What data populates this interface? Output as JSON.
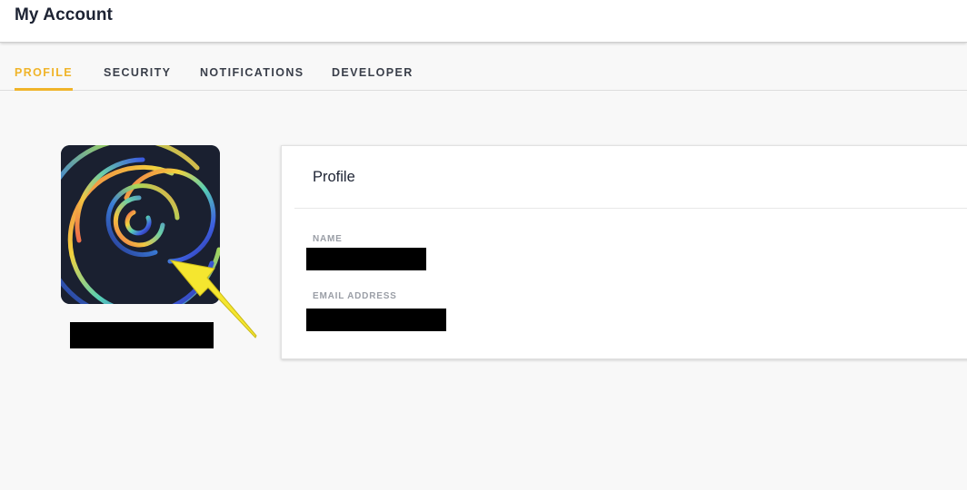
{
  "header": {
    "title": "My Account"
  },
  "tabs": [
    {
      "label": "PROFILE",
      "active": true
    },
    {
      "label": "SECURITY",
      "active": false
    },
    {
      "label": "NOTIFICATIONS",
      "active": false
    },
    {
      "label": "DEVELOPER",
      "active": false
    }
  ],
  "profile_card": {
    "title": "Profile",
    "name_label": "NAME",
    "name_value": "",
    "email_label": "EMAIL ADDRESS",
    "email_value": ""
  },
  "colors": {
    "accent": "#f0b429",
    "annotation_arrow": "#f5e62f",
    "avatar_background": "#1a2030"
  },
  "icons": {
    "avatar": "rainbow-spiral-icon",
    "annotation": "arrow-icon"
  }
}
